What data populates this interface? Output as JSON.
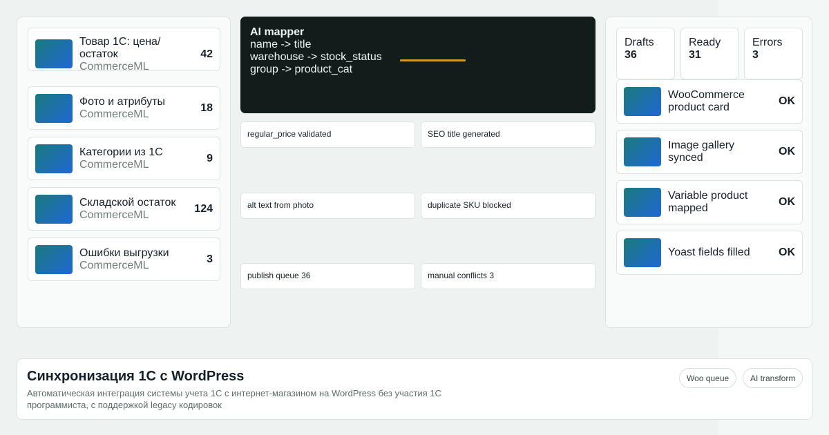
{
  "sources": [
    {
      "title": "Товар 1С: цена/ остаток",
      "subtitle": "CommerceML",
      "count": "42"
    },
    {
      "title": "Фото и атрибуты",
      "subtitle": "CommerceML",
      "count": "18"
    },
    {
      "title": "Категории из 1С",
      "subtitle": "CommerceML",
      "count": "9"
    },
    {
      "title": "Складской остаток",
      "subtitle": "CommerceML",
      "count": "124"
    },
    {
      "title": "Ошибки выгрузки",
      "subtitle": "CommerceML",
      "count": "3"
    }
  ],
  "mapper": {
    "title": "AI mapper",
    "lines": [
      "name -> title",
      "warehouse -> stock_status",
      "group -> product_cat"
    ],
    "accent_color": "#d49a1e"
  },
  "tags": [
    "regular_price validated",
    "SEO title generated",
    "alt text from photo",
    "duplicate SKU blocked",
    "publish queue 36",
    "manual conflicts 3"
  ],
  "stats": [
    {
      "label": "Drafts",
      "value": "36"
    },
    {
      "label": "Ready",
      "value": "31"
    },
    {
      "label": "Errors",
      "value": "3"
    }
  ],
  "outputs": [
    {
      "title": "WooCommerce product card",
      "status": "OK"
    },
    {
      "title": "Image gallery synced",
      "status": "OK"
    },
    {
      "title": "Variable product mapped",
      "status": "OK"
    },
    {
      "title": "Yoast fields filled",
      "status": "OK"
    }
  ],
  "footer": {
    "title": "Синхронизация 1С с WordPress",
    "description": "Автоматическая интеграция системы учета 1С с интернет-магазином на WordPress без участия 1С программиста, с поддержкой legacy кодировок",
    "chips": [
      "Woo queue",
      "AI transform"
    ]
  },
  "colors": {
    "thumb_gradient_start": "#1b7a7c",
    "thumb_gradient_end": "#1f67d4",
    "dark_panel": "#121d1b"
  }
}
